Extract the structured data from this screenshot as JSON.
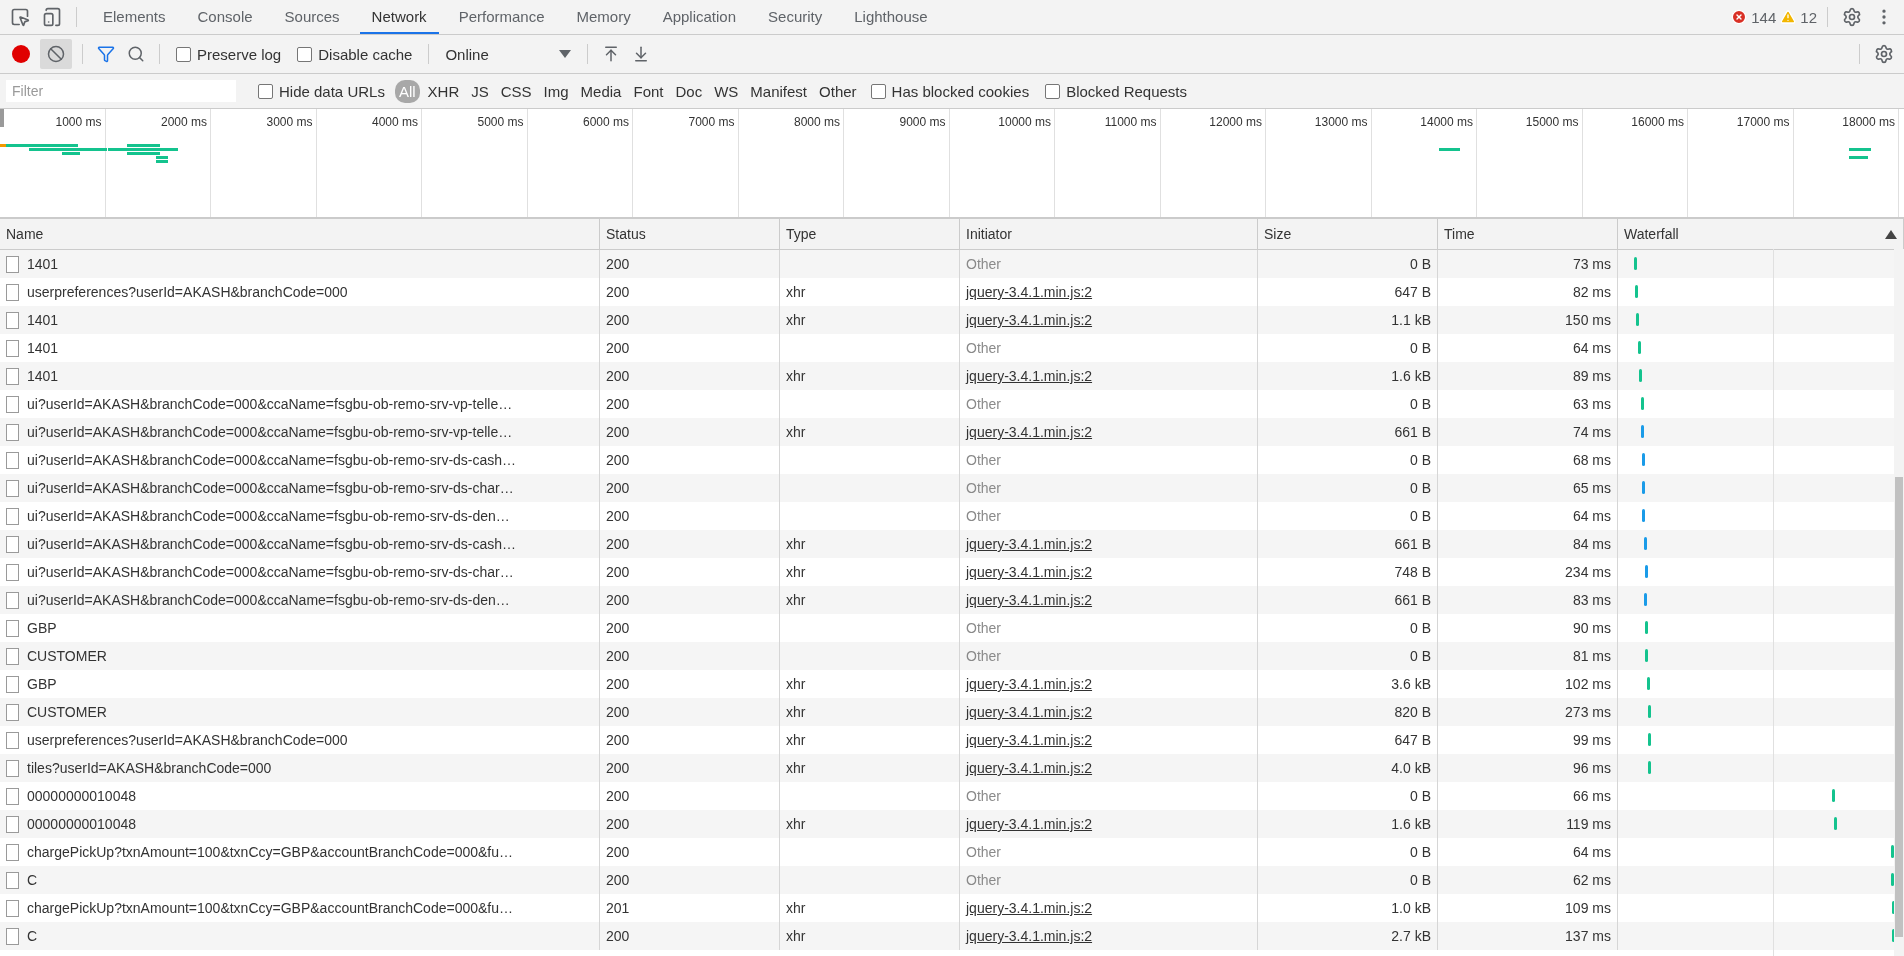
{
  "tabs": [
    {
      "label": "Elements",
      "selected": false
    },
    {
      "label": "Console",
      "selected": false
    },
    {
      "label": "Sources",
      "selected": false
    },
    {
      "label": "Network",
      "selected": true
    },
    {
      "label": "Performance",
      "selected": false
    },
    {
      "label": "Memory",
      "selected": false
    },
    {
      "label": "Application",
      "selected": false
    },
    {
      "label": "Security",
      "selected": false
    },
    {
      "label": "Lighthouse",
      "selected": false
    }
  ],
  "errors": "144",
  "warnings": "12",
  "toolbar": {
    "recording": true,
    "preserve_log": {
      "label": "Preserve log",
      "checked": false
    },
    "disable_cache": {
      "label": "Disable cache",
      "checked": false
    },
    "throttling": "Online"
  },
  "filter_bar": {
    "placeholder": "Filter",
    "hide_data_urls": {
      "label": "Hide data URLs",
      "checked": false
    },
    "types": [
      {
        "label": "All",
        "selected": true
      },
      {
        "label": "XHR",
        "selected": false
      },
      {
        "label": "JS",
        "selected": false
      },
      {
        "label": "CSS",
        "selected": false
      },
      {
        "label": "Img",
        "selected": false
      },
      {
        "label": "Media",
        "selected": false
      },
      {
        "label": "Font",
        "selected": false
      },
      {
        "label": "Doc",
        "selected": false
      },
      {
        "label": "WS",
        "selected": false
      },
      {
        "label": "Manifest",
        "selected": false
      },
      {
        "label": "Other",
        "selected": false
      }
    ],
    "has_blocked_cookies": {
      "label": "Has blocked cookies",
      "checked": false
    },
    "blocked_requests": {
      "label": "Blocked Requests",
      "checked": false
    }
  },
  "overview": {
    "ticks": [
      "1000 ms",
      "2000 ms",
      "3000 ms",
      "4000 ms",
      "5000 ms",
      "6000 ms",
      "7000 ms",
      "8000 ms",
      "9000 ms",
      "10000 ms",
      "11000 ms",
      "12000 ms",
      "13000 ms",
      "14000 ms",
      "15000 ms",
      "16000 ms",
      "17000 ms",
      "18000 ms"
    ]
  },
  "table": {
    "columns": [
      "Name",
      "Status",
      "Type",
      "Initiator",
      "Size",
      "Time",
      "Waterfall"
    ],
    "rows": [
      {
        "name": "1401",
        "status": "200",
        "initiator": {
          "text": "Other",
          "link": false
        },
        "size": "0 B",
        "time": "73 ms"
      },
      {
        "name": "userpreferences?userId=AKASH&branchCode=000",
        "status": "200",
        "type": "xhr",
        "initiator": {
          "text": "jquery-3.4.1.min.js:2",
          "link": true
        },
        "size": "647 B",
        "time": "82 ms"
      },
      {
        "name": "1401",
        "status": "200",
        "type": "xhr",
        "initiator": {
          "text": "jquery-3.4.1.min.js:2",
          "link": true
        },
        "size": "1.1 kB",
        "time": "150 ms"
      },
      {
        "name": "1401",
        "status": "200",
        "initiator": {
          "text": "Other",
          "link": false
        },
        "size": "0 B",
        "time": "64 ms"
      },
      {
        "name": "1401",
        "status": "200",
        "type": "xhr",
        "initiator": {
          "text": "jquery-3.4.1.min.js:2",
          "link": true
        },
        "size": "1.6 kB",
        "time": "89 ms"
      },
      {
        "name": "ui?userId=AKASH&branchCode=000&ccaName=fsgbu-ob-remo-srv-vp-telle…",
        "status": "200",
        "initiator": {
          "text": "Other",
          "link": false
        },
        "size": "0 B",
        "time": "63 ms"
      },
      {
        "name": "ui?userId=AKASH&branchCode=000&ccaName=fsgbu-ob-remo-srv-vp-telle…",
        "status": "200",
        "type": "xhr",
        "initiator": {
          "text": "jquery-3.4.1.min.js:2",
          "link": true
        },
        "size": "661 B",
        "time": "74 ms"
      },
      {
        "name": "ui?userId=AKASH&branchCode=000&ccaName=fsgbu-ob-remo-srv-ds-cash…",
        "status": "200",
        "initiator": {
          "text": "Other",
          "link": false
        },
        "size": "0 B",
        "time": "68 ms"
      },
      {
        "name": "ui?userId=AKASH&branchCode=000&ccaName=fsgbu-ob-remo-srv-ds-char…",
        "status": "200",
        "initiator": {
          "text": "Other",
          "link": false
        },
        "size": "0 B",
        "time": "65 ms"
      },
      {
        "name": "ui?userId=AKASH&branchCode=000&ccaName=fsgbu-ob-remo-srv-ds-den…",
        "status": "200",
        "initiator": {
          "text": "Other",
          "link": false
        },
        "size": "0 B",
        "time": "64 ms"
      },
      {
        "name": "ui?userId=AKASH&branchCode=000&ccaName=fsgbu-ob-remo-srv-ds-cash…",
        "status": "200",
        "type": "xhr",
        "initiator": {
          "text": "jquery-3.4.1.min.js:2",
          "link": true
        },
        "size": "661 B",
        "time": "84 ms"
      },
      {
        "name": "ui?userId=AKASH&branchCode=000&ccaName=fsgbu-ob-remo-srv-ds-char…",
        "status": "200",
        "type": "xhr",
        "initiator": {
          "text": "jquery-3.4.1.min.js:2",
          "link": true
        },
        "size": "748 B",
        "time": "234 ms"
      },
      {
        "name": "ui?userId=AKASH&branchCode=000&ccaName=fsgbu-ob-remo-srv-ds-den…",
        "status": "200",
        "type": "xhr",
        "initiator": {
          "text": "jquery-3.4.1.min.js:2",
          "link": true
        },
        "size": "661 B",
        "time": "83 ms"
      },
      {
        "name": "GBP",
        "status": "200",
        "initiator": {
          "text": "Other",
          "link": false
        },
        "size": "0 B",
        "time": "90 ms"
      },
      {
        "name": "CUSTOMER",
        "status": "200",
        "initiator": {
          "text": "Other",
          "link": false
        },
        "size": "0 B",
        "time": "81 ms"
      },
      {
        "name": "GBP",
        "status": "200",
        "type": "xhr",
        "initiator": {
          "text": "jquery-3.4.1.min.js:2",
          "link": true
        },
        "size": "3.6 kB",
        "time": "102 ms"
      },
      {
        "name": "CUSTOMER",
        "status": "200",
        "type": "xhr",
        "initiator": {
          "text": "jquery-3.4.1.min.js:2",
          "link": true
        },
        "size": "820 B",
        "time": "273 ms"
      },
      {
        "name": "userpreferences?userId=AKASH&branchCode=000",
        "status": "200",
        "type": "xhr",
        "initiator": {
          "text": "jquery-3.4.1.min.js:2",
          "link": true
        },
        "size": "647 B",
        "time": "99 ms"
      },
      {
        "name": "tiles?userId=AKASH&branchCode=000",
        "status": "200",
        "type": "xhr",
        "initiator": {
          "text": "jquery-3.4.1.min.js:2",
          "link": true
        },
        "size": "4.0 kB",
        "time": "96 ms"
      },
      {
        "name": "00000000010048",
        "status": "200",
        "initiator": {
          "text": "Other",
          "link": false
        },
        "size": "0 B",
        "time": "66 ms"
      },
      {
        "name": "00000000010048",
        "status": "200",
        "type": "xhr",
        "initiator": {
          "text": "jquery-3.4.1.min.js:2",
          "link": true
        },
        "size": "1.6 kB",
        "time": "119 ms"
      },
      {
        "name": "chargePickUp?txnAmount=100&txnCcy=GBP&accountBranchCode=000&fu…",
        "status": "200",
        "initiator": {
          "text": "Other",
          "link": false
        },
        "size": "0 B",
        "time": "64 ms"
      },
      {
        "name": "C",
        "status": "200",
        "initiator": {
          "text": "Other",
          "link": false
        },
        "size": "0 B",
        "time": "62 ms"
      },
      {
        "name": "chargePickUp?txnAmount=100&txnCcy=GBP&accountBranchCode=000&fu…",
        "status": "201",
        "type": "xhr",
        "initiator": {
          "text": "jquery-3.4.1.min.js:2",
          "link": true
        },
        "size": "1.0 kB",
        "time": "109 ms"
      },
      {
        "name": "C",
        "status": "200",
        "type": "xhr",
        "initiator": {
          "text": "jquery-3.4.1.min.js:2",
          "link": true
        },
        "size": "2.7 kB",
        "time": "137 ms"
      }
    ]
  }
}
